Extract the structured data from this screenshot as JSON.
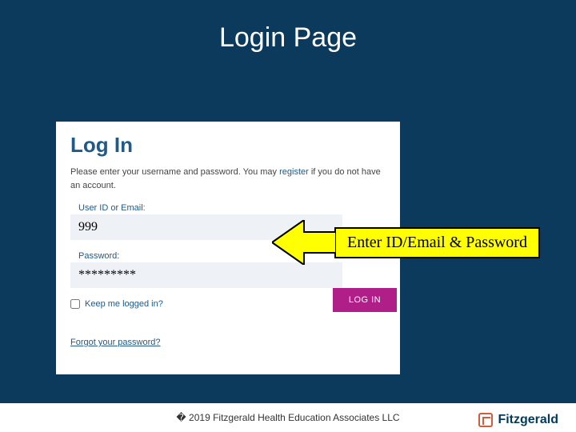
{
  "slide": {
    "title": "Login Page"
  },
  "login": {
    "heading": "Log In",
    "instruction_pre": "Please enter your username and password. You may ",
    "register_text": "register",
    "instruction_post": " if you do not have an account.",
    "user_label": "User ID or Email:",
    "user_value": "999",
    "password_label": "Password:",
    "password_value": "*********",
    "keep_logged_label": "Keep me logged in?",
    "login_button_label": "LOG IN",
    "forgot_label": "Forgot your password?"
  },
  "callout": {
    "text": "Enter ID/Email & Password"
  },
  "footer": {
    "copyright": "� 2019 Fitzgerald Health Education Associates LLC",
    "brand": "Fitzgerald"
  }
}
